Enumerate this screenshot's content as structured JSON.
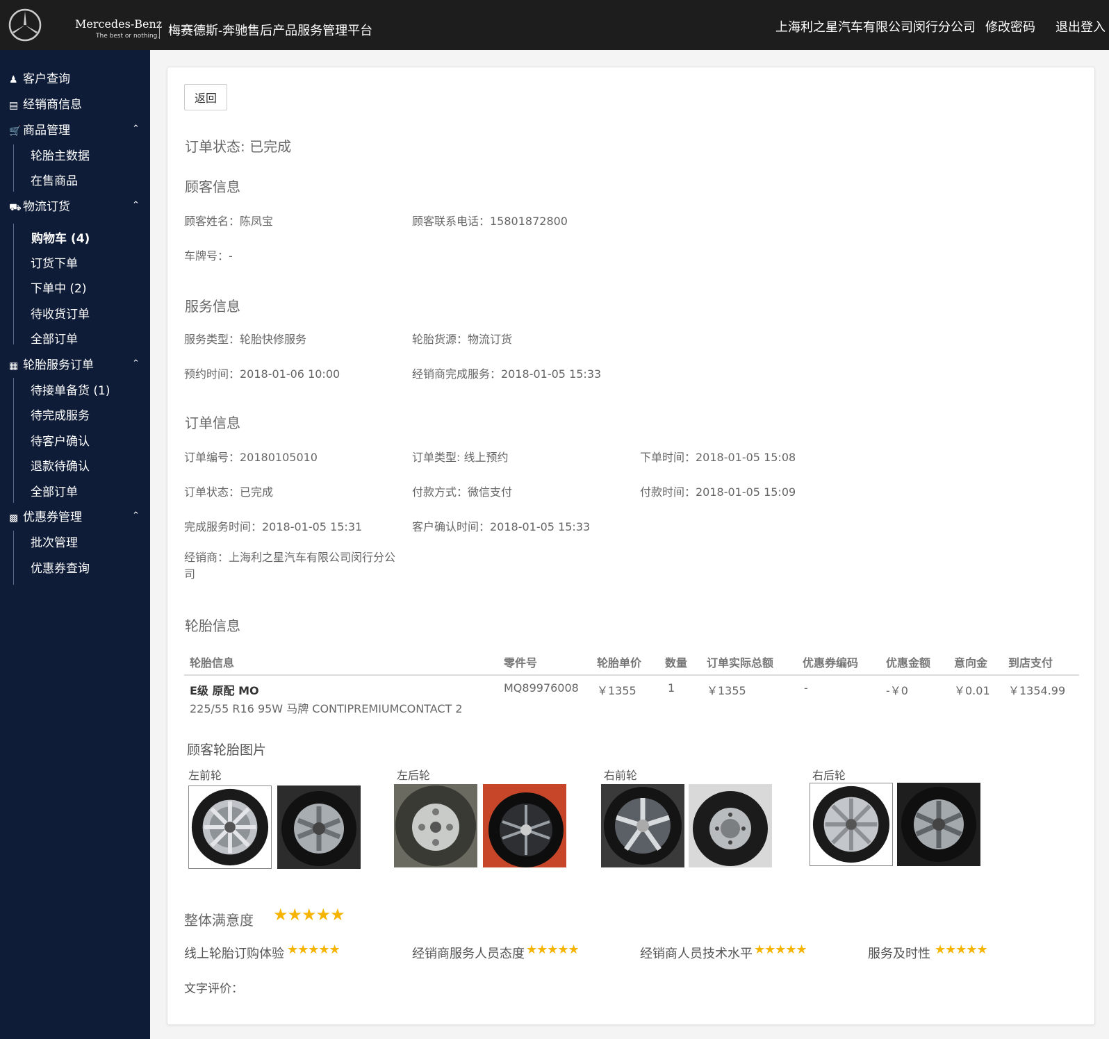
{
  "header": {
    "brand": "Mercedes-Benz",
    "tagline": "The best or nothing.",
    "platform": "梅赛德斯-奔驰售后产品服务管理平台",
    "dealer": "上海利之星汽车有限公司闵行分公司",
    "change_password": "修改密码",
    "logout": "退出登入"
  },
  "sidebar": {
    "customer_query": "客户查询",
    "dealer_info": "经销商信息",
    "goods_mgmt": "商品管理",
    "goods_sub": [
      "轮胎主数据",
      "在售商品"
    ],
    "logistics": "物流订货",
    "logistics_sub": [
      "购物车 (4)",
      "订货下单",
      "下单中 (2)",
      "待收货订单",
      "全部订单"
    ],
    "tire_service": "轮胎服务订单",
    "tire_service_sub": [
      "待接单备货 (1)",
      "待完成服务",
      "待客户确认",
      "退款待确认",
      "全部订单"
    ],
    "coupon_mgmt": "优惠券管理",
    "coupon_sub": [
      "批次管理",
      "优惠券查询"
    ]
  },
  "main": {
    "back": "返回",
    "order_status_line": "订单状态:  已完成",
    "customer_section": "顾客信息",
    "customer_name": "顾客姓名：陈凤宝",
    "customer_phone": "顾客联系电话：15801872800",
    "plate": "车牌号：-",
    "service_section": "服务信息",
    "service_type": "服务类型：轮胎快修服务",
    "tire_source": "轮胎货源：物流订货",
    "appointment": "预约时间：2018-01-06 10:00",
    "dealer_done": "经销商完成服务：2018-01-05 15:33",
    "order_section": "订单信息",
    "order_no": "订单编号：20180105010",
    "order_type": "订单类型: 线上预约",
    "order_time": "下单时间：2018-01-05 15:08",
    "order_status": "订单状态：已完成",
    "pay_method": "付款方式：微信支付",
    "pay_time": "付款时间：2018-01-05 15:09",
    "finish_time": "完成服务时间：2018-01-05 15:31",
    "confirm_time": "客户确认时间：2018-01-05 15:33",
    "dealer": "经销商：上海利之星汽车有限公司闵行分公司",
    "tire_section": "轮胎信息"
  },
  "table": {
    "headers": [
      "轮胎信息",
      "零件号",
      "轮胎单价",
      "数量",
      "订单实际总额",
      "优惠券编码",
      "优惠金额",
      "意向金",
      "到店支付"
    ],
    "row": {
      "name": "E级 原配 MO",
      "spec": "225/55 R16 95W 马牌 CONTIPREMIUMCONTACT 2",
      "part_no": "MQ89976008",
      "unit_price": "￥1355",
      "qty": "1",
      "total": "￥1355",
      "coupon_code": "-",
      "discount": "-￥0",
      "deposit": "￥0.01",
      "pay_in_store": "￥1354.99"
    }
  },
  "photos": {
    "title": "顾客轮胎图片",
    "labels": [
      "左前轮",
      "左后轮",
      "右前轮",
      "右后轮"
    ]
  },
  "ratings": {
    "overall": "整体满意度",
    "overall_stars": "★★★★★",
    "online": "线上轮胎订购体验",
    "staff_attitude": "经销商服务人员态度",
    "tech_level": "经销商人员技术水平",
    "timeliness": "服务及时性",
    "stars": "★★★★★",
    "text_review": "文字评价："
  },
  "colors": {
    "header_bg": "#1d1d1d",
    "sidebar_bg": "#0e1c38",
    "star": "#f5b400"
  }
}
